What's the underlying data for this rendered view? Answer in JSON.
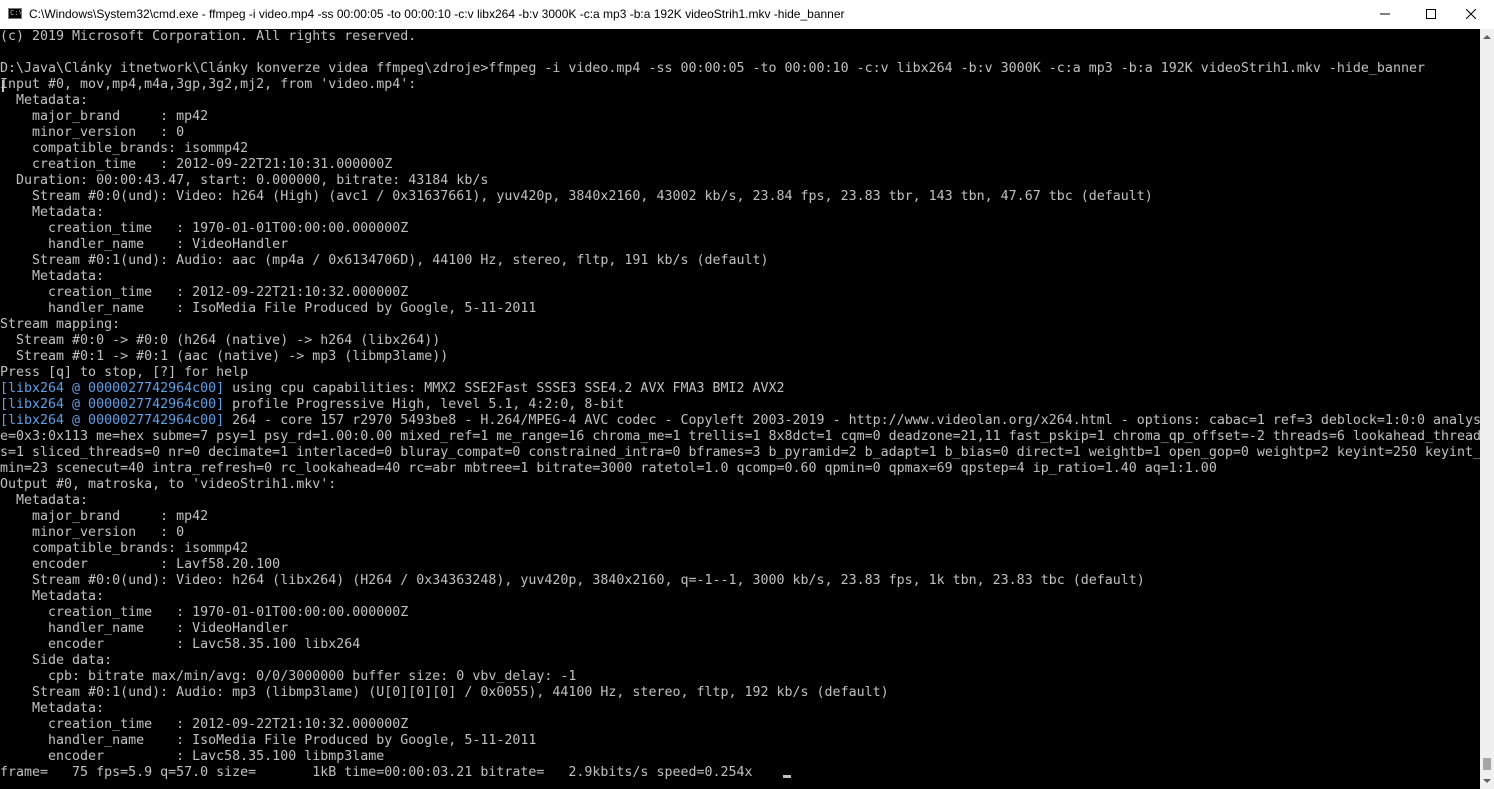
{
  "window": {
    "title": "C:\\Windows\\System32\\cmd.exe - ffmpeg  -i video.mp4 -ss 00:00:05 -to 00:00:10 -c:v libx264 -b:v 3000K -c:a mp3 -b:a 192K videoStrih1.mkv -hide_banner",
    "icon": "console-icon",
    "icon_glyph": "C:\\",
    "controls": [
      "minimize-icon",
      "maximize-icon",
      "close-icon"
    ]
  },
  "colors": {
    "background": "#000000",
    "text": "#c0c0c0",
    "libx264_prefix": "#5aa0e8",
    "titlebar": "#ffffff"
  },
  "console": {
    "lines": [
      {
        "text": "(c) 2019 Microsoft Corporation. All rights reserved."
      },
      {
        "text": ""
      },
      {
        "text": "D:\\Java\\Články itnetwork\\Články konverze videa ffmpeg\\zdroje>ffmpeg -i video.mp4 -ss 00:00:05 -to 00:00:10 -c:v libx264 -b:v 3000K -c:a mp3 -b:a 192K videoStrih1.mkv -hide_banner"
      },
      {
        "text": "Input #0, mov,mp4,m4a,3gp,3g2,mj2, from 'video.mp4':"
      },
      {
        "text": "  Metadata:"
      },
      {
        "text": "    major_brand     : mp42"
      },
      {
        "text": "    minor_version   : 0"
      },
      {
        "text": "    compatible_brands: isommp42"
      },
      {
        "text": "    creation_time   : 2012-09-22T21:10:31.000000Z"
      },
      {
        "text": "  Duration: 00:00:43.47, start: 0.000000, bitrate: 43184 kb/s"
      },
      {
        "text": "    Stream #0:0(und): Video: h264 (High) (avc1 / 0x31637661), yuv420p, 3840x2160, 43002 kb/s, 23.84 fps, 23.83 tbr, 143 tbn, 47.67 tbc (default)"
      },
      {
        "text": "    Metadata:"
      },
      {
        "text": "      creation_time   : 1970-01-01T00:00:00.000000Z"
      },
      {
        "text": "      handler_name    : VideoHandler"
      },
      {
        "text": "    Stream #0:1(und): Audio: aac (mp4a / 0x6134706D), 44100 Hz, stereo, fltp, 191 kb/s (default)"
      },
      {
        "text": "    Metadata:"
      },
      {
        "text": "      creation_time   : 2012-09-22T21:10:32.000000Z"
      },
      {
        "text": "      handler_name    : IsoMedia File Produced by Google, 5-11-2011"
      },
      {
        "text": "Stream mapping:"
      },
      {
        "text": "  Stream #0:0 -> #0:0 (h264 (native) -> h264 (libx264))"
      },
      {
        "text": "  Stream #0:1 -> #0:1 (aac (native) -> mp3 (libmp3lame))"
      },
      {
        "text": "Press [q] to stop, [?] for help"
      },
      {
        "prefix": "[libx264 @ 0000027742964c00]",
        "text": " using cpu capabilities: MMX2 SSE2Fast SSSE3 SSE4.2 AVX FMA3 BMI2 AVX2"
      },
      {
        "prefix": "[libx264 @ 0000027742964c00]",
        "text": " profile Progressive High, level 5.1, 4:2:0, 8-bit"
      },
      {
        "prefix": "[libx264 @ 0000027742964c00]",
        "text": " 264 - core 157 r2970 5493be8 - H.264/MPEG-4 AVC codec - Copyleft 2003-2019 - http://www.videolan.org/x264.html - options: cabac=1 ref=3 deblock=1:0:0 analys"
      },
      {
        "text": "e=0x3:0x113 me=hex subme=7 psy=1 psy_rd=1.00:0.00 mixed_ref=1 me_range=16 chroma_me=1 trellis=1 8x8dct=1 cqm=0 deadzone=21,11 fast_pskip=1 chroma_qp_offset=-2 threads=6 lookahead_thread"
      },
      {
        "text": "s=1 sliced_threads=0 nr=0 decimate=1 interlaced=0 bluray_compat=0 constrained_intra=0 bframes=3 b_pyramid=2 b_adapt=1 b_bias=0 direct=1 weightb=1 open_gop=0 weightp=2 keyint=250 keyint_"
      },
      {
        "text": "min=23 scenecut=40 intra_refresh=0 rc_lookahead=40 rc=abr mbtree=1 bitrate=3000 ratetol=1.0 qcomp=0.60 qpmin=0 qpmax=69 qpstep=4 ip_ratio=1.40 aq=1:1.00"
      },
      {
        "text": "Output #0, matroska, to 'videoStrih1.mkv':"
      },
      {
        "text": "  Metadata:"
      },
      {
        "text": "    major_brand     : mp42"
      },
      {
        "text": "    minor_version   : 0"
      },
      {
        "text": "    compatible_brands: isommp42"
      },
      {
        "text": "    encoder         : Lavf58.20.100"
      },
      {
        "text": "    Stream #0:0(und): Video: h264 (libx264) (H264 / 0x34363248), yuv420p, 3840x2160, q=-1--1, 3000 kb/s, 23.83 fps, 1k tbn, 23.83 tbc (default)"
      },
      {
        "text": "    Metadata:"
      },
      {
        "text": "      creation_time   : 1970-01-01T00:00:00.000000Z"
      },
      {
        "text": "      handler_name    : VideoHandler"
      },
      {
        "text": "      encoder         : Lavc58.35.100 libx264"
      },
      {
        "text": "    Side data:"
      },
      {
        "text": "      cpb: bitrate max/min/avg: 0/0/3000000 buffer size: 0 vbv_delay: -1"
      },
      {
        "text": "    Stream #0:1(und): Audio: mp3 (libmp3lame) (U[0][0][0] / 0x0055), 44100 Hz, stereo, fltp, 192 kb/s (default)"
      },
      {
        "text": "    Metadata:"
      },
      {
        "text": "      creation_time   : 2012-09-22T21:10:32.000000Z"
      },
      {
        "text": "      handler_name    : IsoMedia File Produced by Google, 5-11-2011"
      },
      {
        "text": "      encoder         : Lavc58.35.100 libmp3lame"
      },
      {
        "text": "frame=   75 fps=5.9 q=57.0 size=       1kB time=00:00:03.21 bitrate=   2.9kbits/s speed=0.254x"
      }
    ]
  },
  "scrollbar": {
    "up_icon": "chevron-up-icon",
    "down_icon": "chevron-down-icon"
  }
}
